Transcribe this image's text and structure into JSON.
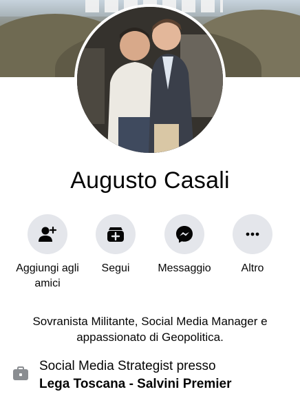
{
  "profile": {
    "name": "Augusto Casali",
    "bio": "Sovranista Militante, Social Media Manager e appassionato di Geopolitica."
  },
  "actions": [
    {
      "label": "Aggiungi agli amici",
      "icon": "add-friend-icon"
    },
    {
      "label": "Segui",
      "icon": "follow-icon"
    },
    {
      "label": "Messaggio",
      "icon": "messenger-icon"
    },
    {
      "label": "Altro",
      "icon": "more-icon"
    }
  ],
  "work": {
    "title": "Social Media Strategist presso",
    "company": "Lega Toscana - Salvini Premier",
    "icon": "briefcase-icon"
  },
  "colors": {
    "button_bg": "#e4e6eb",
    "icon_color": "#050505",
    "work_icon": "#8a8d91"
  }
}
